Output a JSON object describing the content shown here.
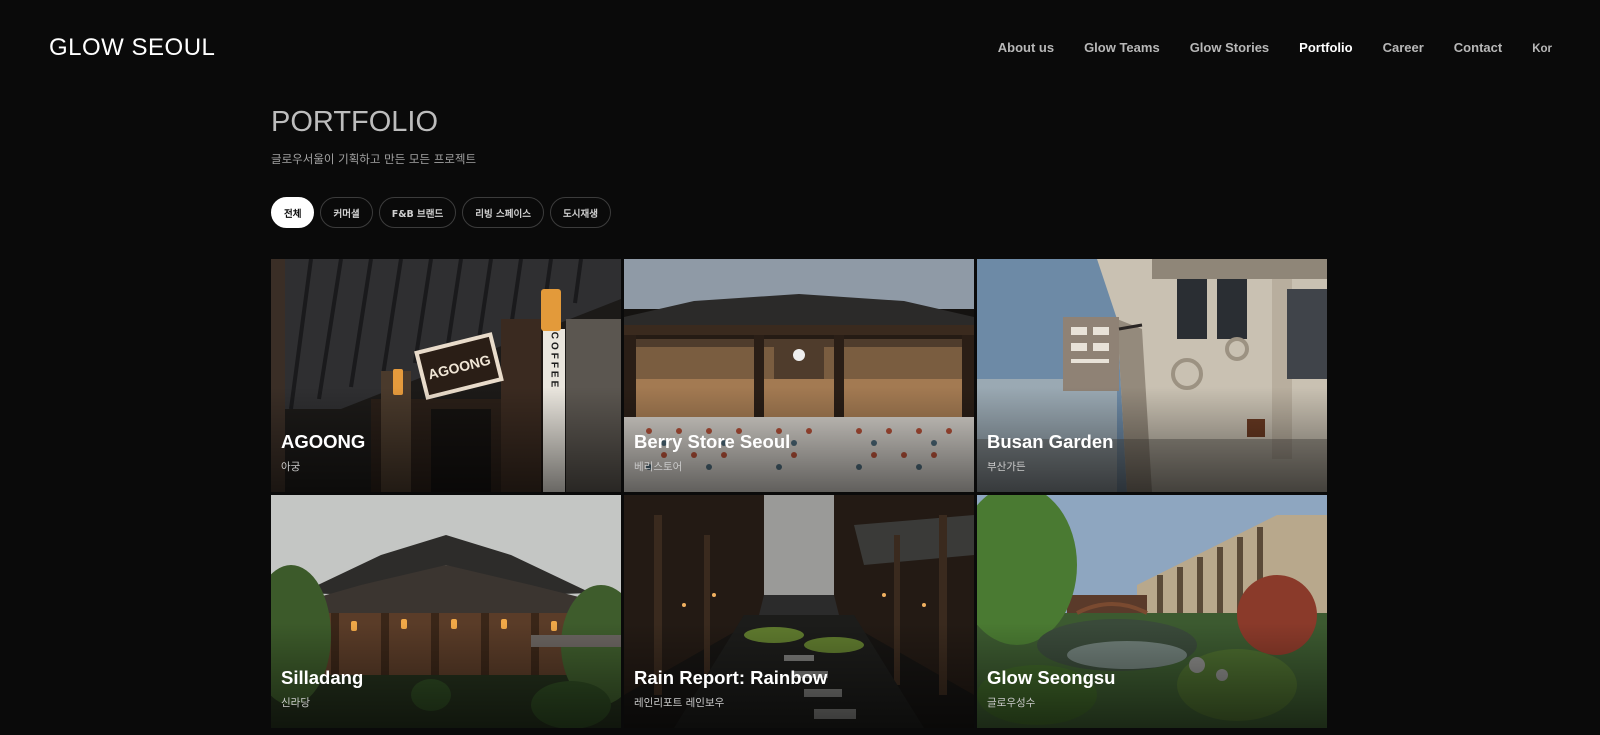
{
  "brand": "GLOW SEOUL",
  "nav": {
    "items": [
      {
        "label": "About us",
        "active": false
      },
      {
        "label": "Glow Teams",
        "active": false
      },
      {
        "label": "Glow Stories",
        "active": false
      },
      {
        "label": "Portfolio",
        "active": true
      },
      {
        "label": "Career",
        "active": false
      },
      {
        "label": "Contact",
        "active": false
      }
    ],
    "language": "Kor"
  },
  "page": {
    "title": "PORTFOLIO",
    "subtitle": "글로우서울이 기획하고 만든 모든 프로젝트"
  },
  "filters": [
    {
      "label": "전체",
      "active": true
    },
    {
      "label": "커머셜",
      "active": false
    },
    {
      "label": "F&B 브랜드",
      "active": false
    },
    {
      "label": "리빙 스페이스",
      "active": false
    },
    {
      "label": "도시재생",
      "active": false
    }
  ],
  "projects": [
    {
      "name": "AGOONG",
      "korean": "아궁",
      "sign": "AGOONG",
      "side_sign": "COFFEE"
    },
    {
      "name": "Berry Store Seoul",
      "korean": "베리스토어"
    },
    {
      "name": "Busan Garden",
      "korean": "부산가든"
    },
    {
      "name": "Silladang",
      "korean": "신라당"
    },
    {
      "name": "Rain Report: Rainbow",
      "korean": "레인리포트 레인보우"
    },
    {
      "name": "Glow Seongsu",
      "korean": "글로우성수"
    }
  ],
  "colors": {
    "background": "#0a0a0a",
    "nav_text": "#b8b8b8",
    "nav_active": "#ffffff",
    "chip_border": "#3c3c3c",
    "chip_active_bg": "#ffffff"
  }
}
